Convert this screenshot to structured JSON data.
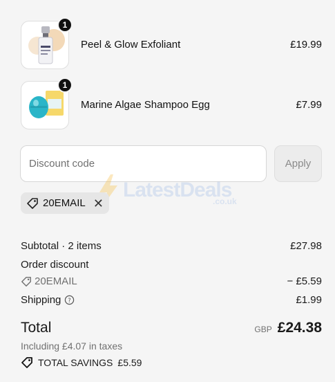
{
  "cart": {
    "items": [
      {
        "name": "Peel & Glow Exfoliant",
        "price": "£19.99",
        "quantity": "1",
        "image_icon": "serum-bottle-image"
      },
      {
        "name": "Marine Algae Shampoo Egg",
        "price": "£7.99",
        "quantity": "1",
        "image_icon": "shampoo-egg-image"
      }
    ]
  },
  "discount": {
    "placeholder": "Discount code",
    "apply_label": "Apply",
    "applied_code": "20EMAIL"
  },
  "watermark": {
    "text": "LatestDeals",
    "sub": ".co.uk"
  },
  "summary": {
    "subtotal_label": "Subtotal · 2 items",
    "subtotal_value": "£27.98",
    "order_discount_label": "Order discount",
    "order_discount_code": "20EMAIL",
    "order_discount_value": "− £5.59",
    "shipping_label": "Shipping",
    "shipping_value": "£1.99",
    "total_label": "Total",
    "currency": "GBP",
    "total_value": "£24.38",
    "taxes_note": "Including £4.07 in taxes",
    "savings_label": "TOTAL SAVINGS",
    "savings_value": "£5.59"
  },
  "colors": {
    "background": "#f5f5f5",
    "badge": "#111111",
    "muted": "#707070"
  }
}
